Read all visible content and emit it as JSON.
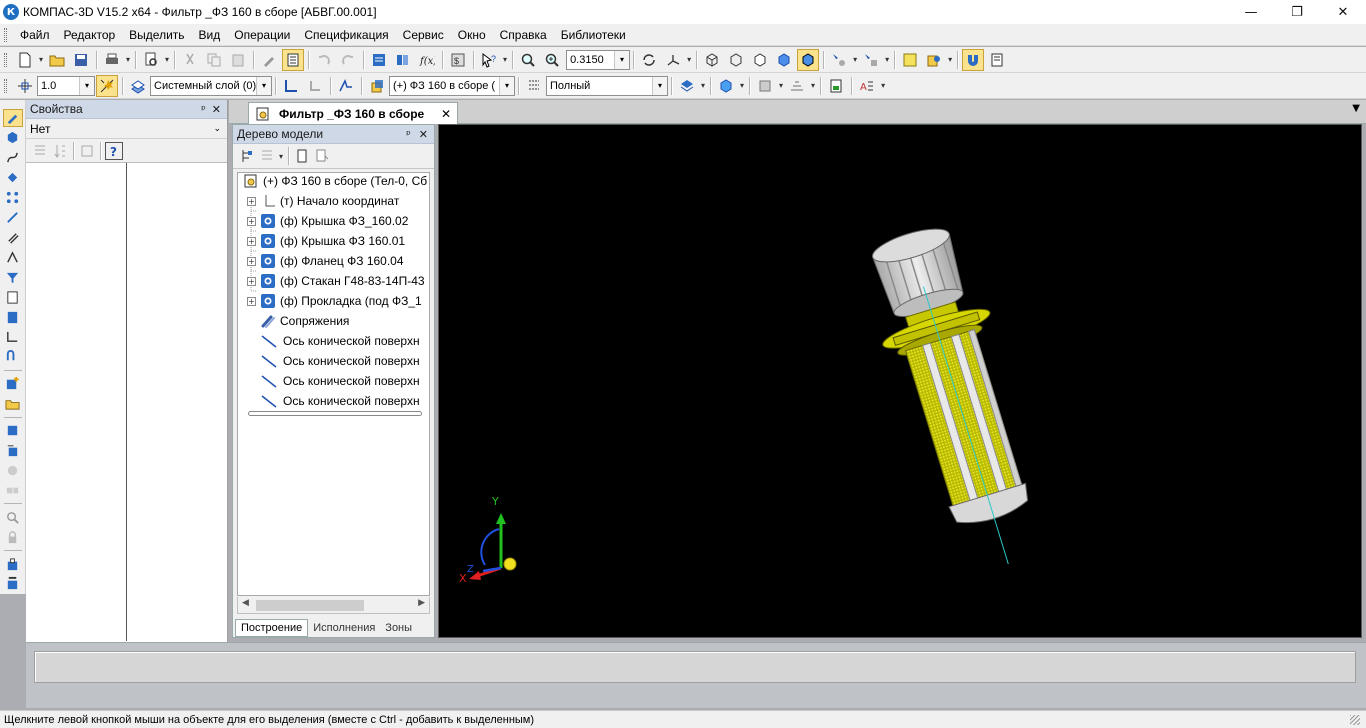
{
  "window": {
    "title": "КОМПАС-3D V15.2  x64 - Фильтр _ФЗ 160 в сборе  [АБВГ.00.001]",
    "app_icon": "К",
    "minimize_glyph": "—",
    "maximize_glyph": "❐",
    "close_glyph": "✕"
  },
  "menu": [
    "Файл",
    "Редактор",
    "Выделить",
    "Вид",
    "Операции",
    "Спецификация",
    "Сервис",
    "Окно",
    "Справка",
    "Библиотеки"
  ],
  "toolbar1": {
    "zoom_value": "0.3150"
  },
  "toolbar2": {
    "line_step": "1.0",
    "layer": "Системный слой (0)",
    "component": "(+) ФЗ 160 в сборе (",
    "display_mode": "Полный"
  },
  "properties_panel": {
    "title": "Свойства",
    "object_select": "Нет",
    "pin_glyph": "ᵖ",
    "close_glyph": "✕"
  },
  "document_tab": {
    "label": "Фильтр _ФЗ 160 в сборе",
    "close_glyph": "✕"
  },
  "model_tree": {
    "title": "Дерево модели",
    "items": [
      {
        "label": "(+) ФЗ 160 в сборе (Тел-0, Сб",
        "icon": "assembly-icon"
      },
      {
        "label": "(т) Начало координат",
        "icon": "origin-icon"
      },
      {
        "label": "(ф) Крышка ФЗ_160.02",
        "icon": "part-icon"
      },
      {
        "label": "(ф) Крышка ФЗ 160.01",
        "icon": "part-icon"
      },
      {
        "label": "(ф) Фланец ФЗ 160.04",
        "icon": "part-icon"
      },
      {
        "label": "(ф) Стакан Г48-83-14П-43",
        "icon": "part-icon"
      },
      {
        "label": "(ф) Прокладка (под ФЗ_1",
        "icon": "part-icon"
      },
      {
        "label": "Сопряжения",
        "icon": "mates-icon"
      },
      {
        "label": "Ось конической поверхн",
        "icon": "axis-icon"
      },
      {
        "label": "Ось конической поверхн",
        "icon": "axis-icon"
      },
      {
        "label": "Ось конической поверхн",
        "icon": "axis-icon"
      },
      {
        "label": "Ось конической поверхн",
        "icon": "axis-icon"
      }
    ],
    "tabs": [
      "Построение",
      "Исполнения",
      "Зоны"
    ]
  },
  "viewport": {
    "background": "#000000",
    "axis_labels": {
      "x": "X",
      "y": "Y",
      "z": "Z"
    },
    "colors": {
      "x_axis": "#e02020",
      "y_axis": "#20c020",
      "z_axis": "#2050e0",
      "model_yellow": "#d6d600",
      "model_gray": "#cfcfcf"
    }
  },
  "status": {
    "text": "Щелкните левой кнопкой мыши на объекте для его выделения (вместе с Ctrl - добавить к выделенным)"
  }
}
